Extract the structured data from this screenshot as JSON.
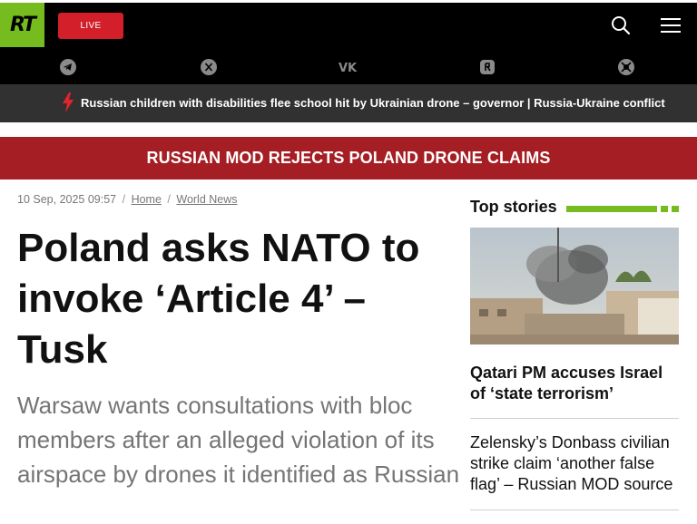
{
  "header": {
    "logo_text": "RT",
    "live_label": "LIVE",
    "brand_color": "#77bc1f",
    "live_color": "#d21f2a",
    "icons": [
      "search-icon",
      "menu-icon"
    ]
  },
  "social": {
    "icons": [
      "telegram-icon",
      "x-icon",
      "vk-icon",
      "rumble-icon",
      "odysee-icon"
    ]
  },
  "ticker": {
    "text": "Russian children with disabilities flee school hit by Ukrainian drone – governor | Russia-Ukraine conflict"
  },
  "banner": {
    "text": "RUSSIAN MOD REJECTS POLAND DRONE CLAIMS",
    "color": "#a41e24"
  },
  "article": {
    "date": "10 Sep, 2025 09:57",
    "breadcrumb": [
      "Home",
      "World News"
    ],
    "breadcrumb_sep": "/",
    "headline": "Poland asks NATO to invoke ‘Article 4’ – Tusk",
    "lede": "Warsaw wants consultations with bloc members after an alleged violation of its airspace by drones it identified as Russian"
  },
  "sidebar": {
    "title": "Top stories",
    "stories": [
      {
        "title": "Qatari PM accuses Israel of ‘state terrorism’"
      },
      {
        "title": "Zelensky’s Donbass civilian strike claim ‘another false flag’ – Russian MOD source"
      }
    ]
  }
}
